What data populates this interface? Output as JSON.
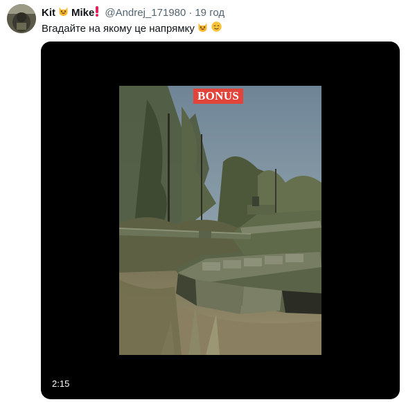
{
  "tweet": {
    "display_name_part1": "Kit",
    "display_name_part2": "Mike",
    "emoji_name_1": "grinning-cat-icon",
    "emoji_name_2": "exclamation-icon",
    "handle": "@Andrej_171980",
    "separator": "·",
    "time": "19 год",
    "text": "Вгадайте на якому це напрямку",
    "text_emojis": [
      "grinning-cat-icon",
      "relieved-face-icon"
    ]
  },
  "media": {
    "badge": "BONUS",
    "duration": "2:15",
    "background_color": "#000000",
    "badge_color": "#e2443a"
  },
  "colors": {
    "name": "#0f1419",
    "secondary": "#536471",
    "exclamation": "#e0245e"
  }
}
